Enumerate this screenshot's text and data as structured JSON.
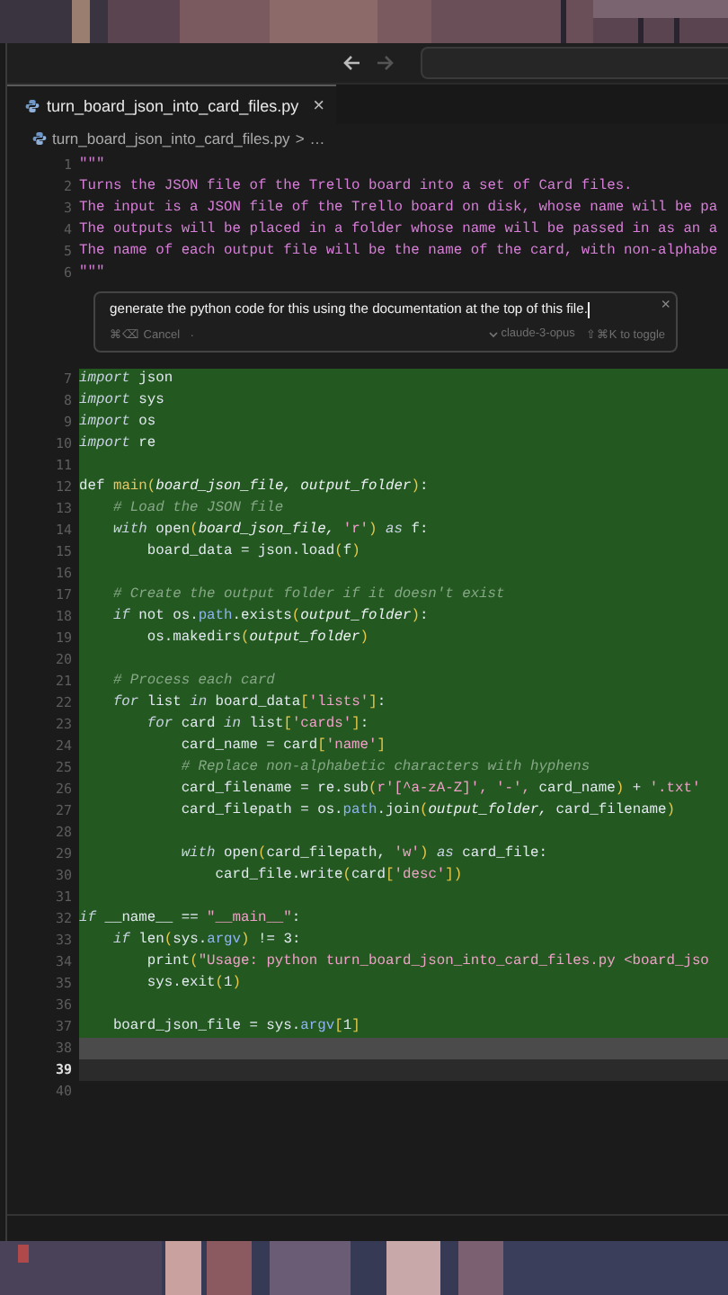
{
  "title_bar": {
    "back_disabled": false,
    "forward_disabled": true
  },
  "tabs": [
    {
      "label": "turn_board_json_into_card_files.py",
      "selected": true,
      "close": "×"
    }
  ],
  "breadcrumb": {
    "file": "turn_board_json_into_card_files.py",
    "separator": ">",
    "more": "…"
  },
  "code_before": [
    {
      "number": "1",
      "segments": [
        {
          "text": "\"\"\"",
          "kind": "doc"
        }
      ]
    },
    {
      "number": "2",
      "segments": [
        {
          "text": "Turns the JSON file of the Trello board into a set of Card files.",
          "kind": "doc"
        }
      ]
    },
    {
      "number": "3",
      "segments": [
        {
          "text": "The input is a JSON file of the Trello board on disk, whose name will be pa",
          "kind": "doc"
        }
      ]
    },
    {
      "number": "4",
      "segments": [
        {
          "text": "The outputs will be placed in a folder whose name will be passed in as an a",
          "kind": "doc"
        }
      ]
    },
    {
      "number": "5",
      "segments": [
        {
          "text": "The name of each output file will be the name of the card, with non-alphabe",
          "kind": "doc"
        }
      ]
    },
    {
      "number": "6",
      "segments": [
        {
          "text": "\"\"\"",
          "kind": "doc"
        }
      ]
    }
  ],
  "prompt": {
    "value": "generate the python code for this using the documentation at the top of this file.",
    "close": "×",
    "cancel": "⌘⌫ Cancel",
    "separator": ".",
    "model": "claude-3-opus",
    "toggle": "⇧⌘K to toggle"
  },
  "code_after": [
    {
      "number": "7",
      "kind": "inserted",
      "segments": [
        {
          "text": "import",
          "kind": "keyword"
        },
        {
          "text": " json",
          "kind": "plain"
        }
      ]
    },
    {
      "number": "8",
      "kind": "inserted",
      "segments": [
        {
          "text": "import",
          "kind": "keyword"
        },
        {
          "text": " sys",
          "kind": "plain"
        }
      ]
    },
    {
      "number": "9",
      "kind": "inserted",
      "segments": [
        {
          "text": "import",
          "kind": "keyword"
        },
        {
          "text": " os",
          "kind": "plain"
        }
      ]
    },
    {
      "number": "10",
      "kind": "inserted",
      "segments": [
        {
          "text": "import",
          "kind": "keyword"
        },
        {
          "text": " re",
          "kind": "plain"
        }
      ]
    },
    {
      "number": "11",
      "kind": "inserted"
    },
    {
      "number": "12",
      "kind": "inserted",
      "segments": [
        {
          "text": "def ",
          "kind": "plain"
        },
        {
          "text": "main",
          "kind": "func"
        },
        {
          "text": "(",
          "kind": "punct"
        },
        {
          "text": "board_json_file, output_folder",
          "kind": "param"
        },
        {
          "text": ")",
          "kind": "punct"
        },
        {
          "text": ":",
          "kind": "plain"
        }
      ]
    },
    {
      "number": "13",
      "kind": "inserted",
      "segments": [
        {
          "text": "    # Load the JSON file",
          "kind": "comment"
        }
      ]
    },
    {
      "number": "14",
      "kind": "inserted",
      "segments": [
        {
          "text": "    with",
          "kind": "keyword"
        },
        {
          "text": " open",
          "kind": "plain"
        },
        {
          "text": "(",
          "kind": "punct"
        },
        {
          "text": "board_json_file,",
          "kind": "param"
        },
        {
          "text": " 'r'",
          "kind": "string"
        },
        {
          "text": ")",
          "kind": "punct"
        },
        {
          "text": " as",
          "kind": "keyword"
        },
        {
          "text": " f:",
          "kind": "plain"
        }
      ]
    },
    {
      "number": "15",
      "kind": "inserted",
      "segments": [
        {
          "text": "        board_data = json.load",
          "kind": "plain"
        },
        {
          "text": "(",
          "kind": "punct"
        },
        {
          "text": "f",
          "kind": "plain"
        },
        {
          "text": ")",
          "kind": "punct"
        }
      ]
    },
    {
      "number": "16",
      "kind": "inserted"
    },
    {
      "number": "17",
      "kind": "inserted",
      "segments": [
        {
          "text": "    # Create the output folder if it doesn't exist",
          "kind": "comment"
        }
      ]
    },
    {
      "number": "18",
      "kind": "inserted",
      "segments": [
        {
          "text": "    if",
          "kind": "keyword"
        },
        {
          "text": " not os.",
          "kind": "plain"
        },
        {
          "text": "path",
          "kind": "attr"
        },
        {
          "text": ".exists",
          "kind": "plain"
        },
        {
          "text": "(",
          "kind": "punct"
        },
        {
          "text": "output_folder",
          "kind": "param"
        },
        {
          "text": ")",
          "kind": "punct"
        },
        {
          "text": ":",
          "kind": "plain"
        }
      ]
    },
    {
      "number": "19",
      "kind": "inserted",
      "segments": [
        {
          "text": "        os.makedirs",
          "kind": "plain"
        },
        {
          "text": "(",
          "kind": "punct"
        },
        {
          "text": "output_folder",
          "kind": "param"
        },
        {
          "text": ")",
          "kind": "punct"
        }
      ]
    },
    {
      "number": "20",
      "kind": "inserted"
    },
    {
      "number": "21",
      "kind": "inserted",
      "segments": [
        {
          "text": "    # Process each card",
          "kind": "comment"
        }
      ]
    },
    {
      "number": "22",
      "kind": "inserted",
      "segments": [
        {
          "text": "    for",
          "kind": "keyword"
        },
        {
          "text": " list ",
          "kind": "plain"
        },
        {
          "text": "in",
          "kind": "keyword"
        },
        {
          "text": " board_data",
          "kind": "plain"
        },
        {
          "text": "[",
          "kind": "punct"
        },
        {
          "text": "'lists'",
          "kind": "string"
        },
        {
          "text": "]",
          "kind": "punct"
        },
        {
          "text": ":",
          "kind": "plain"
        }
      ]
    },
    {
      "number": "23",
      "kind": "inserted",
      "segments": [
        {
          "text": "        for",
          "kind": "keyword"
        },
        {
          "text": " card ",
          "kind": "plain"
        },
        {
          "text": "in",
          "kind": "keyword"
        },
        {
          "text": " list",
          "kind": "plain"
        },
        {
          "text": "[",
          "kind": "punct"
        },
        {
          "text": "'cards'",
          "kind": "string"
        },
        {
          "text": "]",
          "kind": "punct"
        },
        {
          "text": ":",
          "kind": "plain"
        }
      ]
    },
    {
      "number": "24",
      "kind": "inserted",
      "segments": [
        {
          "text": "            card_name = card",
          "kind": "plain"
        },
        {
          "text": "[",
          "kind": "punct"
        },
        {
          "text": "'name'",
          "kind": "string"
        },
        {
          "text": "]",
          "kind": "punct"
        }
      ]
    },
    {
      "number": "25",
      "kind": "inserted",
      "segments": [
        {
          "text": "            # Replace non-alphabetic characters with hyphens",
          "kind": "comment"
        }
      ]
    },
    {
      "number": "26",
      "kind": "inserted",
      "segments": [
        {
          "text": "            card_filename = re.sub",
          "kind": "plain"
        },
        {
          "text": "(",
          "kind": "punct"
        },
        {
          "text": "r'[^a-zA-Z]', '-',",
          "kind": "string"
        },
        {
          "text": " card_name",
          "kind": "plain"
        },
        {
          "text": ")",
          "kind": "punct"
        },
        {
          "text": " + ",
          "kind": "plain"
        },
        {
          "text": "'.txt'",
          "kind": "string"
        }
      ]
    },
    {
      "number": "27",
      "kind": "inserted",
      "segments": [
        {
          "text": "            card_filepath = os.",
          "kind": "plain"
        },
        {
          "text": "path",
          "kind": "attr"
        },
        {
          "text": ".join",
          "kind": "plain"
        },
        {
          "text": "(",
          "kind": "punct"
        },
        {
          "text": "output_folder,",
          "kind": "param"
        },
        {
          "text": " card_filename",
          "kind": "plain"
        },
        {
          "text": ")",
          "kind": "punct"
        }
      ]
    },
    {
      "number": "28",
      "kind": "inserted"
    },
    {
      "number": "29",
      "kind": "inserted",
      "segments": [
        {
          "text": "            with",
          "kind": "keyword"
        },
        {
          "text": " open",
          "kind": "plain"
        },
        {
          "text": "(",
          "kind": "punct"
        },
        {
          "text": "card_filepath,",
          "kind": "plain"
        },
        {
          "text": " 'w'",
          "kind": "string"
        },
        {
          "text": ")",
          "kind": "punct"
        },
        {
          "text": " as",
          "kind": "keyword"
        },
        {
          "text": " card_file:",
          "kind": "plain"
        }
      ]
    },
    {
      "number": "30",
      "kind": "inserted",
      "segments": [
        {
          "text": "                card_file.write",
          "kind": "plain"
        },
        {
          "text": "(",
          "kind": "punct"
        },
        {
          "text": "card",
          "kind": "plain"
        },
        {
          "text": "[",
          "kind": "punct"
        },
        {
          "text": "'desc'",
          "kind": "string"
        },
        {
          "text": "])",
          "kind": "punct"
        }
      ]
    },
    {
      "number": "31",
      "kind": "inserted"
    },
    {
      "number": "32",
      "kind": "inserted",
      "segments": [
        {
          "text": "if",
          "kind": "keyword"
        },
        {
          "text": " __name__ == ",
          "kind": "plain"
        },
        {
          "text": "\"__main__\"",
          "kind": "string"
        },
        {
          "text": ":",
          "kind": "plain"
        }
      ]
    },
    {
      "number": "33",
      "kind": "inserted",
      "segments": [
        {
          "text": "    if",
          "kind": "keyword"
        },
        {
          "text": " len",
          "kind": "plain"
        },
        {
          "text": "(",
          "kind": "punct"
        },
        {
          "text": "sys.",
          "kind": "plain"
        },
        {
          "text": "argv",
          "kind": "attr"
        },
        {
          "text": ")",
          "kind": "punct"
        },
        {
          "text": " != 3:",
          "kind": "plain"
        }
      ]
    },
    {
      "number": "34",
      "kind": "inserted",
      "segments": [
        {
          "text": "        print",
          "kind": "plain"
        },
        {
          "text": "(",
          "kind": "punct"
        },
        {
          "text": "\"Usage: python turn_board_json_into_card_files.py <board_jso",
          "kind": "string"
        }
      ]
    },
    {
      "number": "35",
      "kind": "inserted",
      "segments": [
        {
          "text": "        sys.exit",
          "kind": "plain"
        },
        {
          "text": "(",
          "kind": "punct"
        },
        {
          "text": "1",
          "kind": "plain"
        },
        {
          "text": ")",
          "kind": "punct"
        }
      ]
    },
    {
      "number": "36",
      "kind": "inserted"
    },
    {
      "number": "37",
      "kind": "inserted",
      "segments": [
        {
          "text": "    board_json_file = sys.",
          "kind": "plain"
        },
        {
          "text": "argv",
          "kind": "attr"
        },
        {
          "text": "[",
          "kind": "punct"
        },
        {
          "text": "1",
          "kind": "plain"
        },
        {
          "text": "]",
          "kind": "punct"
        }
      ]
    },
    {
      "number": "38",
      "kind": "pending"
    },
    {
      "number": "39",
      "kind": "current"
    },
    {
      "number": "40"
    }
  ]
}
